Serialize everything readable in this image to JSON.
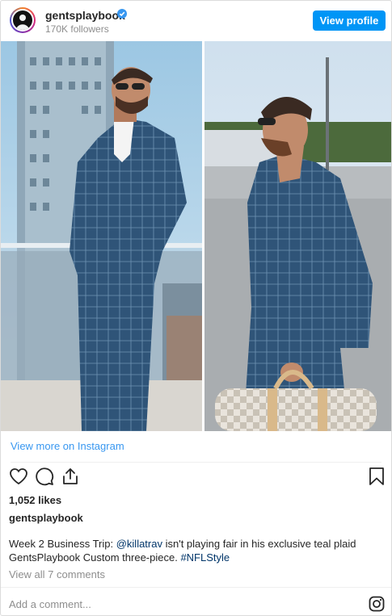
{
  "header": {
    "username": "gentsplaybook",
    "followers": "170K followers",
    "view_profile_label": "View profile"
  },
  "post": {
    "photo_left": "man in blue plaid suit with sunglasses on balcony",
    "photo_right": "man in blue plaid suit with checkered duffle bag on tarmac",
    "view_more_label": "View more on Instagram",
    "likes": "1,052 likes",
    "caption_user": "gentsplaybook",
    "caption_parts": {
      "text1": "Week 2 Business Trip: ",
      "mention": "@killatrav",
      "text2": " isn't playing fair in his exclusive teal plaid GentsPlaybook Custom three-piece. ",
      "hashtag": "#NFLStyle"
    },
    "view_comments_label": "View all 7 comments",
    "add_comment_placeholder": "Add a comment..."
  },
  "icons": {
    "like": "heart-icon",
    "comment": "comment-icon",
    "share": "share-icon",
    "save": "bookmark-icon",
    "instagram": "instagram-icon",
    "verified": "verified-badge-icon"
  },
  "colors": {
    "accent": "#0095f6",
    "link": "#3897f0",
    "hashtag": "#003569",
    "muted": "#8e8e8e"
  }
}
